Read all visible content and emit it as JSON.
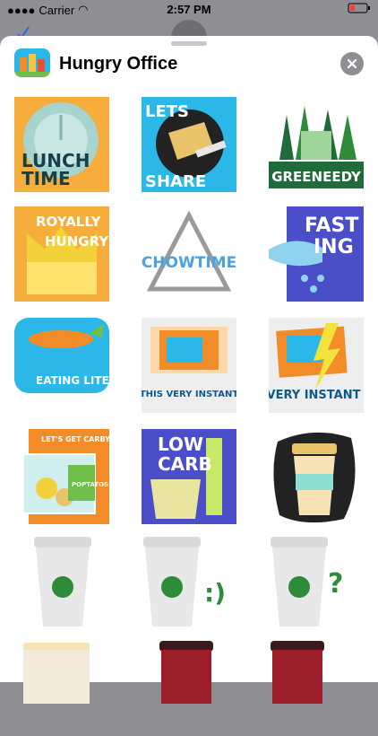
{
  "status": {
    "carrier": "Carrier",
    "time": "2:57 PM"
  },
  "header": {
    "title": "Hungry Office",
    "close_icon": "close-icon"
  },
  "stickers": [
    {
      "name": "lunch-time",
      "line1": "LUNCH",
      "line2": "TIME"
    },
    {
      "name": "lets-share",
      "line1": "LETS",
      "line2": "SHARE"
    },
    {
      "name": "greeneedy",
      "line1": "GREENEEDY"
    },
    {
      "name": "royally-hungry",
      "line1": "ROYALLY",
      "line2": "HUNGRY"
    },
    {
      "name": "chowtime",
      "line1": "CHOWTIME"
    },
    {
      "name": "fasting",
      "line1": "FAST",
      "line2": "ING"
    },
    {
      "name": "eating-lite",
      "line1": "EATING LITE"
    },
    {
      "name": "this-very-instant",
      "line1": "THIS VERY INSTANT"
    },
    {
      "name": "very-instant",
      "line1": "VERY INSTANT"
    },
    {
      "name": "lets-get-carby",
      "line1": "LET'S GET CARBY",
      "line2": "POPTATOS"
    },
    {
      "name": "low-carb",
      "line1": "LOW",
      "line2": "CARB"
    },
    {
      "name": "coffee-cup-sticker"
    },
    {
      "name": "coffee-cup-green"
    },
    {
      "name": "coffee-cup-smile",
      "line1": ":)"
    },
    {
      "name": "coffee-cup-question",
      "line1": "?"
    },
    {
      "name": "mug-partial"
    },
    {
      "name": "red-cup-partial-1"
    },
    {
      "name": "red-cup-partial-2"
    }
  ],
  "colors": {
    "accent_green": "#2e8b3a",
    "sheet": "#ffffff",
    "dim": "#8e8e93"
  }
}
